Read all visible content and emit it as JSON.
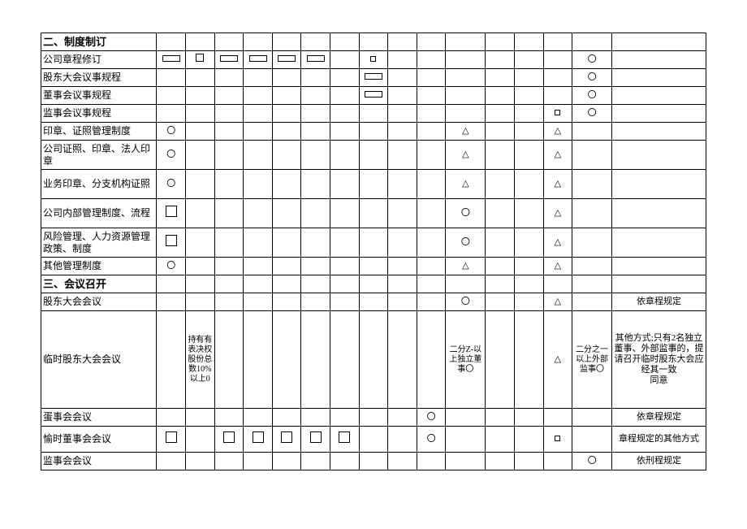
{
  "sections": {
    "s2": "二、制度制订",
    "s3": "三、会议召开"
  },
  "rows": {
    "r1": "公司章程修订",
    "r2": "股东大会议事规程",
    "r3": "董事会议事规程",
    "r4": "监事会议事规程",
    "r5": "印章、证照管理制度",
    "r6": "公司证照、印章、法人印章",
    "r7": "业务印章、分支机构证照",
    "r8": "公司内部管理制度、流程",
    "r9": "风险管理、人力资源管理政策、制度",
    "r10": "其他管理制度",
    "r11": "股东大会会议",
    "r12": "临时股东大会会议",
    "r13": "蛋事会会议",
    "r14": "愉时董事会会议",
    "r15": "监事会会议"
  },
  "marks": {
    "circle": "〇",
    "triangle": "△",
    "r12c2": "持有有表决权股份总数10%以上0",
    "r12c11": "二分Z-以上独立董事〇",
    "r12c15": "二分之一以上外部监事〇",
    "n11": "依章程规定",
    "n12": "其他方式;只有2名独立董事、外部监事的，提请召开临时股东大会应经其一致\n同意",
    "n13": "依章程规定",
    "n14": "章程规定的其他方式",
    "n15": "依刑程规定"
  }
}
